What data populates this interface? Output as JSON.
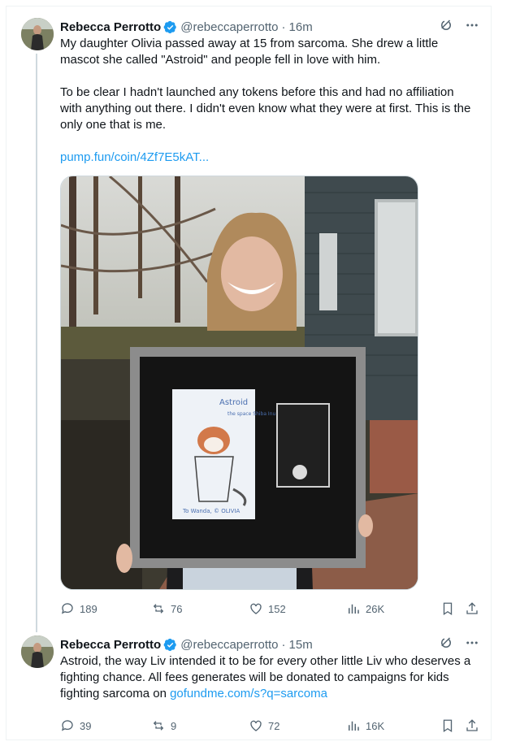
{
  "tweets": [
    {
      "author": {
        "name": "Rebecca Perrotto",
        "handle": "@rebeccaperrotto",
        "time": "16m"
      },
      "paragraphs": [
        "My daughter Olivia passed away at 15 from sarcoma. She drew a little mascot she called \"Astroid\" and people fell in love with him.",
        "To be clear I hadn't launched any tokens before this and had no affiliation with anything out there. I didn't even know what they were at first. This is the only one that is me."
      ],
      "link": "pump.fun/coin/4Zf7E5kAT...",
      "media": {
        "drawing_title": "Astroid",
        "drawing_subtitle": "the space Shiba Inu",
        "drawing_signature": "To Wanda, © OLIVIA"
      },
      "stats": {
        "replies": "189",
        "reposts": "76",
        "likes": "152",
        "views": "26K"
      }
    },
    {
      "author": {
        "name": "Rebecca Perrotto",
        "handle": "@rebeccaperrotto",
        "time": "15m"
      },
      "text_before_link": "Astroid, the way Liv intended it to be for every other little Liv who deserves a fighting chance. All fees generates will be donated to campaigns for kids fighting sarcoma on ",
      "link": "gofundme.com/s?q=sarcoma",
      "stats": {
        "replies": "39",
        "reposts": "9",
        "likes": "72",
        "views": "16K"
      }
    }
  ],
  "icons": {
    "verified": "verified-badge-icon",
    "grok": "grok-icon",
    "more": "more-icon",
    "reply": "reply-icon",
    "repost": "repost-icon",
    "like": "like-icon",
    "views": "views-icon",
    "bookmark": "bookmark-icon",
    "share": "share-icon"
  },
  "colors": {
    "accent": "#1d9bf0",
    "muted": "#536471",
    "text": "#0f1419",
    "border": "#cfd9de"
  }
}
